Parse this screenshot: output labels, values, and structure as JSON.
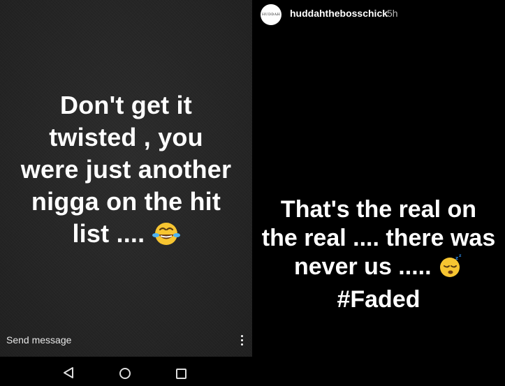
{
  "left_story": {
    "lines": [
      "Don't get it",
      "twisted , you",
      "were just another",
      "nigga on the hit",
      "list ...."
    ],
    "emoji": "tears-of-joy-emoji",
    "send_message_placeholder": "Send message",
    "more_icon": "more-vertical-icon"
  },
  "navbar": {
    "back_icon": "back-triangle-icon",
    "home_icon": "home-circle-icon",
    "recents_icon": "recents-square-icon"
  },
  "right_story": {
    "avatar_logo": "HUDDAH",
    "username": "huddahthebosschick",
    "time_ago": "5h",
    "lines": [
      "That's the real on",
      "the real .... there was",
      "never us .....",
      "#Faded"
    ],
    "emoji": "sleeping-face-emoji"
  }
}
